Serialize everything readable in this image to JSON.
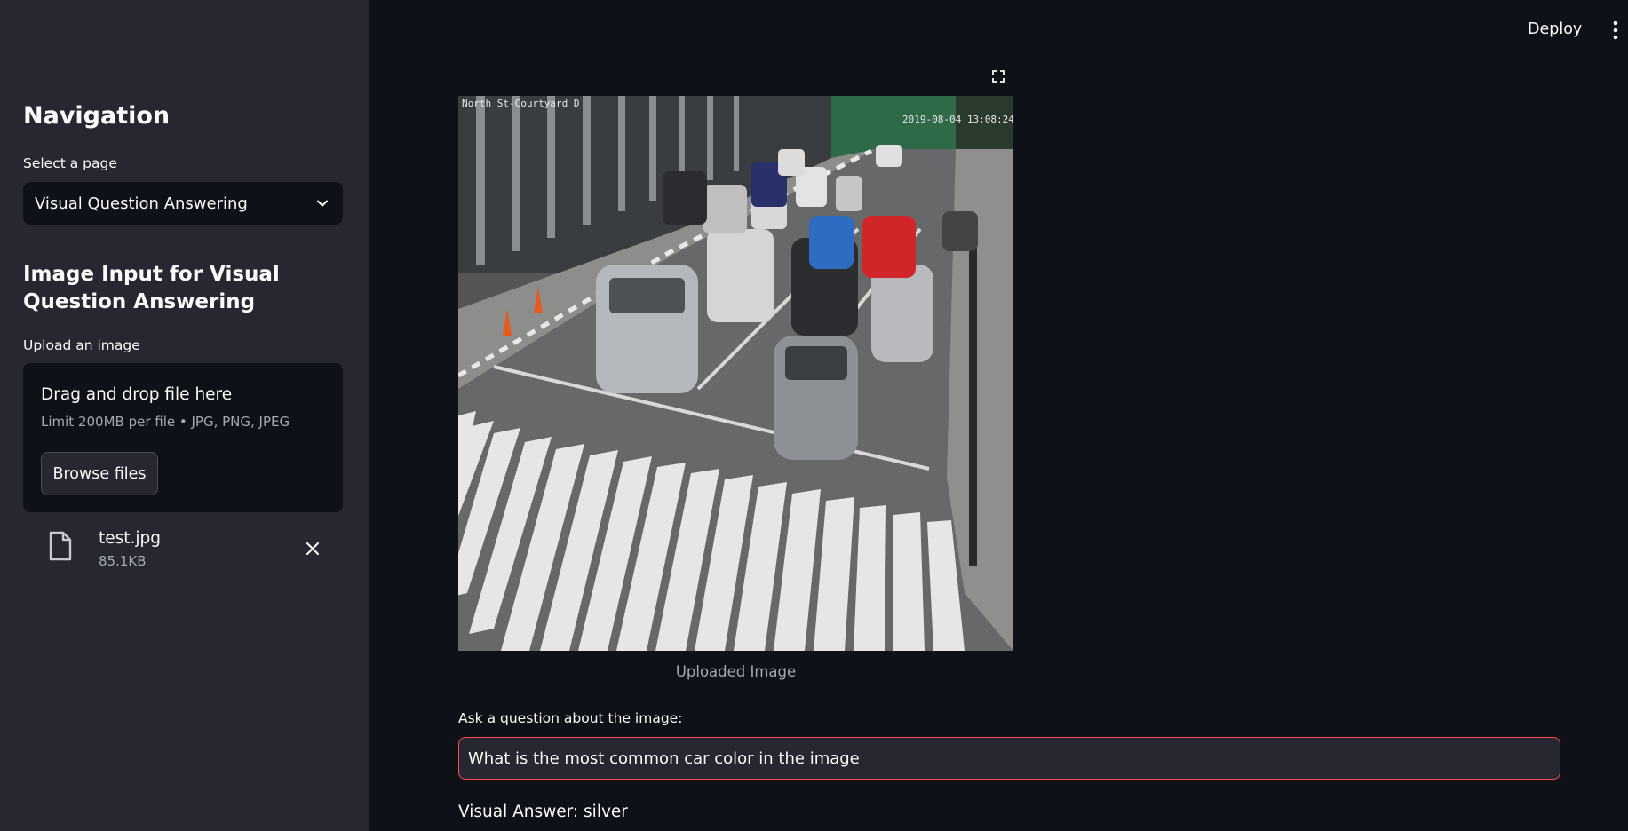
{
  "header": {
    "deploy_label": "Deploy",
    "menu_icon": "vertical-dots-icon"
  },
  "sidebar": {
    "title": "Navigation",
    "select_label": "Select a page",
    "select_value": "Visual Question Answering",
    "section_heading": "Image Input for Visual Question Answering",
    "upload_label": "Upload an image",
    "dropzone": {
      "title": "Drag and drop file here",
      "limit": "Limit 200MB per file • JPG, PNG, JPEG",
      "browse_label": "Browse files"
    },
    "file": {
      "name": "test.jpg",
      "size": "85.1KB"
    }
  },
  "main": {
    "image_caption": "Uploaded Image",
    "question_label": "Ask a question about the image:",
    "question_value": "What is the most common car color in the image",
    "answer": "Visual Answer: silver",
    "photo_overlay": {
      "top_left": "North St-Courtyard D",
      "top_right": "2019-08-04 13:08:24"
    }
  },
  "colors": {
    "accent": "#ff4b4b",
    "sidebar_bg": "#262730",
    "main_bg": "#0e1117"
  }
}
